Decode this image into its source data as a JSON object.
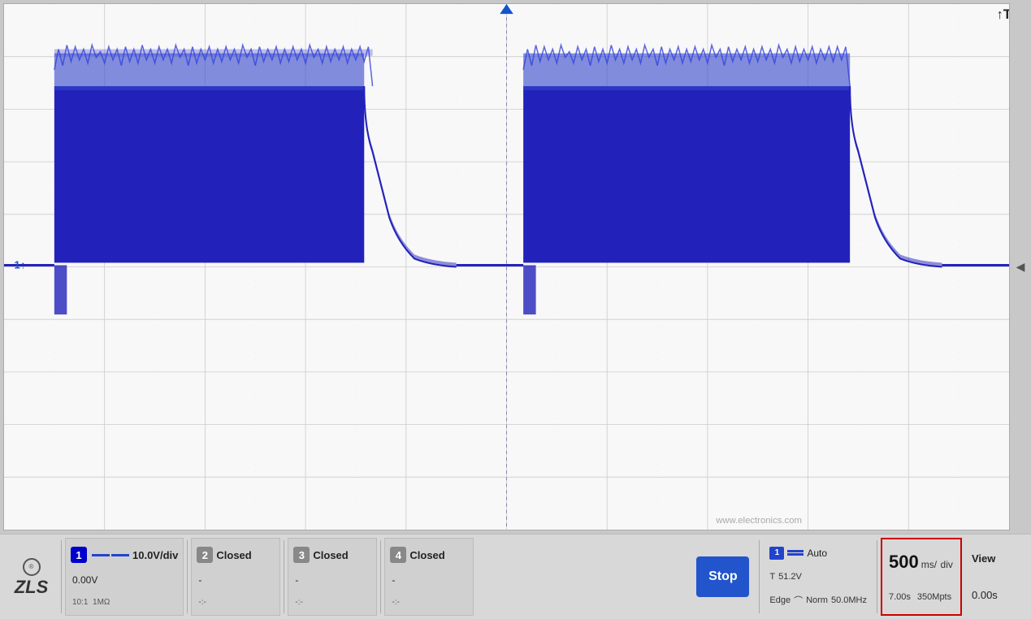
{
  "screen": {
    "trigger_marker": "▼",
    "t_label": "↑T",
    "ch1_marker": "1↑",
    "watermark": "www.electronics.com"
  },
  "status_bar": {
    "logo": {
      "badge": "®",
      "text": "ZLS",
      "sub": ""
    },
    "ch1": {
      "num": "1",
      "volts_per_div": "10.0V/div",
      "offset": "0.00V",
      "detail1": "10:1",
      "detail2": "1MΩ"
    },
    "ch2": {
      "num": "2",
      "status": "Closed",
      "detail1": "-",
      "detail2": "-:-"
    },
    "ch3": {
      "num": "3",
      "status": "Closed",
      "detail1": "-",
      "detail2": "-:-"
    },
    "ch4": {
      "num": "4",
      "status": "Closed",
      "detail1": "-",
      "detail2": "-:-"
    },
    "stop_btn": "Stop",
    "trigger": {
      "ch_num": "1",
      "auto_label": "Auto",
      "t_label": "T",
      "t_value": "51.2V",
      "edge_label": "Edge",
      "edge_symbol": "⌒",
      "norm_label": "Norm",
      "freq_label": "50.0MHz"
    },
    "time": {
      "value": "500",
      "unit": "ms/",
      "unit2": "div",
      "view_offset": "0.00s",
      "total_time": "7.00s",
      "mpts": "350Mpts"
    },
    "view": {
      "label": "View",
      "value": "0.00s"
    }
  }
}
